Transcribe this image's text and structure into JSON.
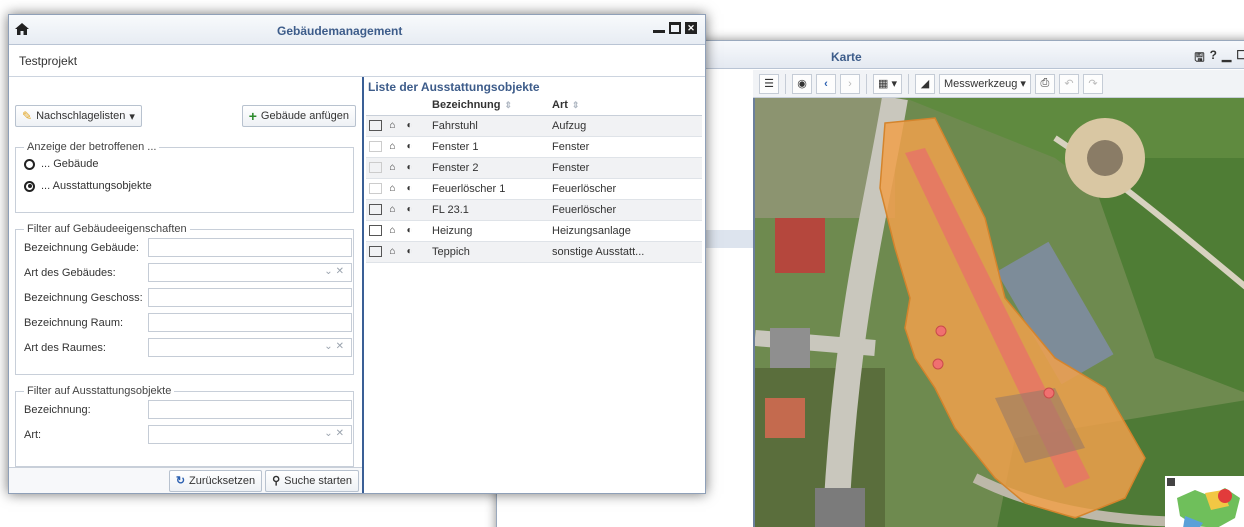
{
  "main_window": {
    "title": "Gebäudemanagement",
    "project": "Testprojekt",
    "toolbar": {
      "lookup_lists_label": "Nachschlagelisten",
      "add_building_label": "Gebäude anfügen"
    },
    "display_group": {
      "legend": "Anzeige der betroffenen ...",
      "options": [
        "... Gebäude",
        "... Ausstattungsobjekte"
      ],
      "selected_index": 1
    },
    "building_filter": {
      "legend": "Filter auf Gebäudeeigenschaften",
      "fields": [
        {
          "label": "Bezeichnung Gebäude:",
          "type": "text",
          "value": ""
        },
        {
          "label": "Art des Gebäudes:",
          "type": "select",
          "value": ""
        },
        {
          "label": "Bezeichnung Geschoss:",
          "type": "text",
          "value": ""
        },
        {
          "label": "Bezeichnung Raum:",
          "type": "text",
          "value": ""
        },
        {
          "label": "Art des Raumes:",
          "type": "select",
          "value": ""
        }
      ]
    },
    "equipment_filter": {
      "legend": "Filter auf Ausstattungsobjekte",
      "fields": [
        {
          "label": "Bezeichnung:",
          "type": "text",
          "value": ""
        },
        {
          "label": "Art:",
          "type": "select",
          "value": ""
        }
      ]
    },
    "buttons": {
      "reset_label": "Zurücksetzen",
      "search_label": "Suche starten"
    },
    "list": {
      "title": "Liste der Ausstattungsobjekte",
      "columns": [
        "Bezeichnung",
        "Art"
      ],
      "rows": [
        {
          "name": "Fahrstuhl",
          "art": "Aufzug",
          "map_enabled": true
        },
        {
          "name": "Fenster 1",
          "art": "Fenster",
          "map_enabled": false
        },
        {
          "name": "Fenster 2",
          "art": "Fenster",
          "map_enabled": false
        },
        {
          "name": "Feuerlöscher 1",
          "art": "Feuerlöscher",
          "map_enabled": false
        },
        {
          "name": "FL 23.1",
          "art": "Feuerlöscher",
          "map_enabled": true
        },
        {
          "name": "Heizung",
          "art": "Heizungsanlage",
          "map_enabled": true
        },
        {
          "name": "Teppich",
          "art": "sonstige Ausstatt...",
          "map_enabled": true
        }
      ]
    }
  },
  "map_window": {
    "title": "Karte",
    "toolbar": {
      "measure_tool_label": "Messwerkzeug"
    }
  },
  "colors": {
    "title_blue": "#3d5c8a",
    "panel_divider": "#3a5f96",
    "building_fill": "#f0a04b",
    "building_highlight": "#e8706a",
    "marker_red": "#f07070"
  }
}
